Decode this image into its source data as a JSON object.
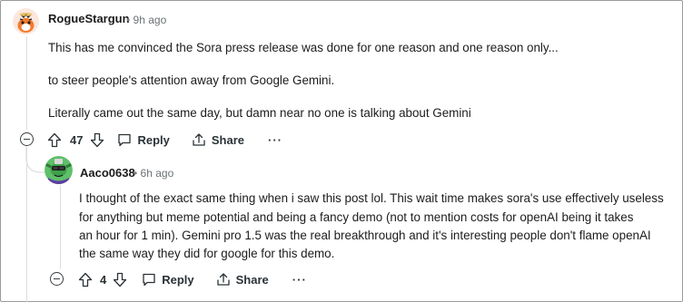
{
  "comments": [
    {
      "username": "RogueStargun",
      "separator": "•",
      "time": "9h ago",
      "paragraphs": [
        "This has me convinced the Sora press release was done for one reason and one reason only...",
        "to steer people's attention away from Google Gemini.",
        "Literally came out the same day, but damn near no one is talking about Gemini"
      ],
      "vote_count": "47",
      "reply_label": "Reply",
      "share_label": "Share",
      "more_label": "···"
    },
    {
      "username": "Aaco0638",
      "separator": "•",
      "time": "6h ago",
      "paragraphs": [
        "I thought of the exact same thing when i saw this post lol. This wait time makes sora's use effectively useless",
        "for anything but meme potential and being a fancy demo (not to mention costs for openAI being it takes",
        "an hour for 1 min). Gemini pro 1.5 was the real breakthrough and it's interesting people don't flame openAI",
        "the same way they did for google for this demo."
      ],
      "vote_count": "4",
      "reply_label": "Reply",
      "share_label": "Share",
      "more_label": "···"
    }
  ],
  "icons": {
    "avatar1": "tiger-avatar-icon",
    "avatar2": "goblin-avatar-icon",
    "upvote": "upvote-arrow-icon",
    "downvote": "downvote-arrow-icon",
    "reply": "comment-bubble-icon",
    "share": "share-icon",
    "collapse": "collapse-minus-icon"
  },
  "colors": {
    "text": "#1c1c1c",
    "muted": "#6b7275",
    "thread_line": "#dadde0"
  }
}
